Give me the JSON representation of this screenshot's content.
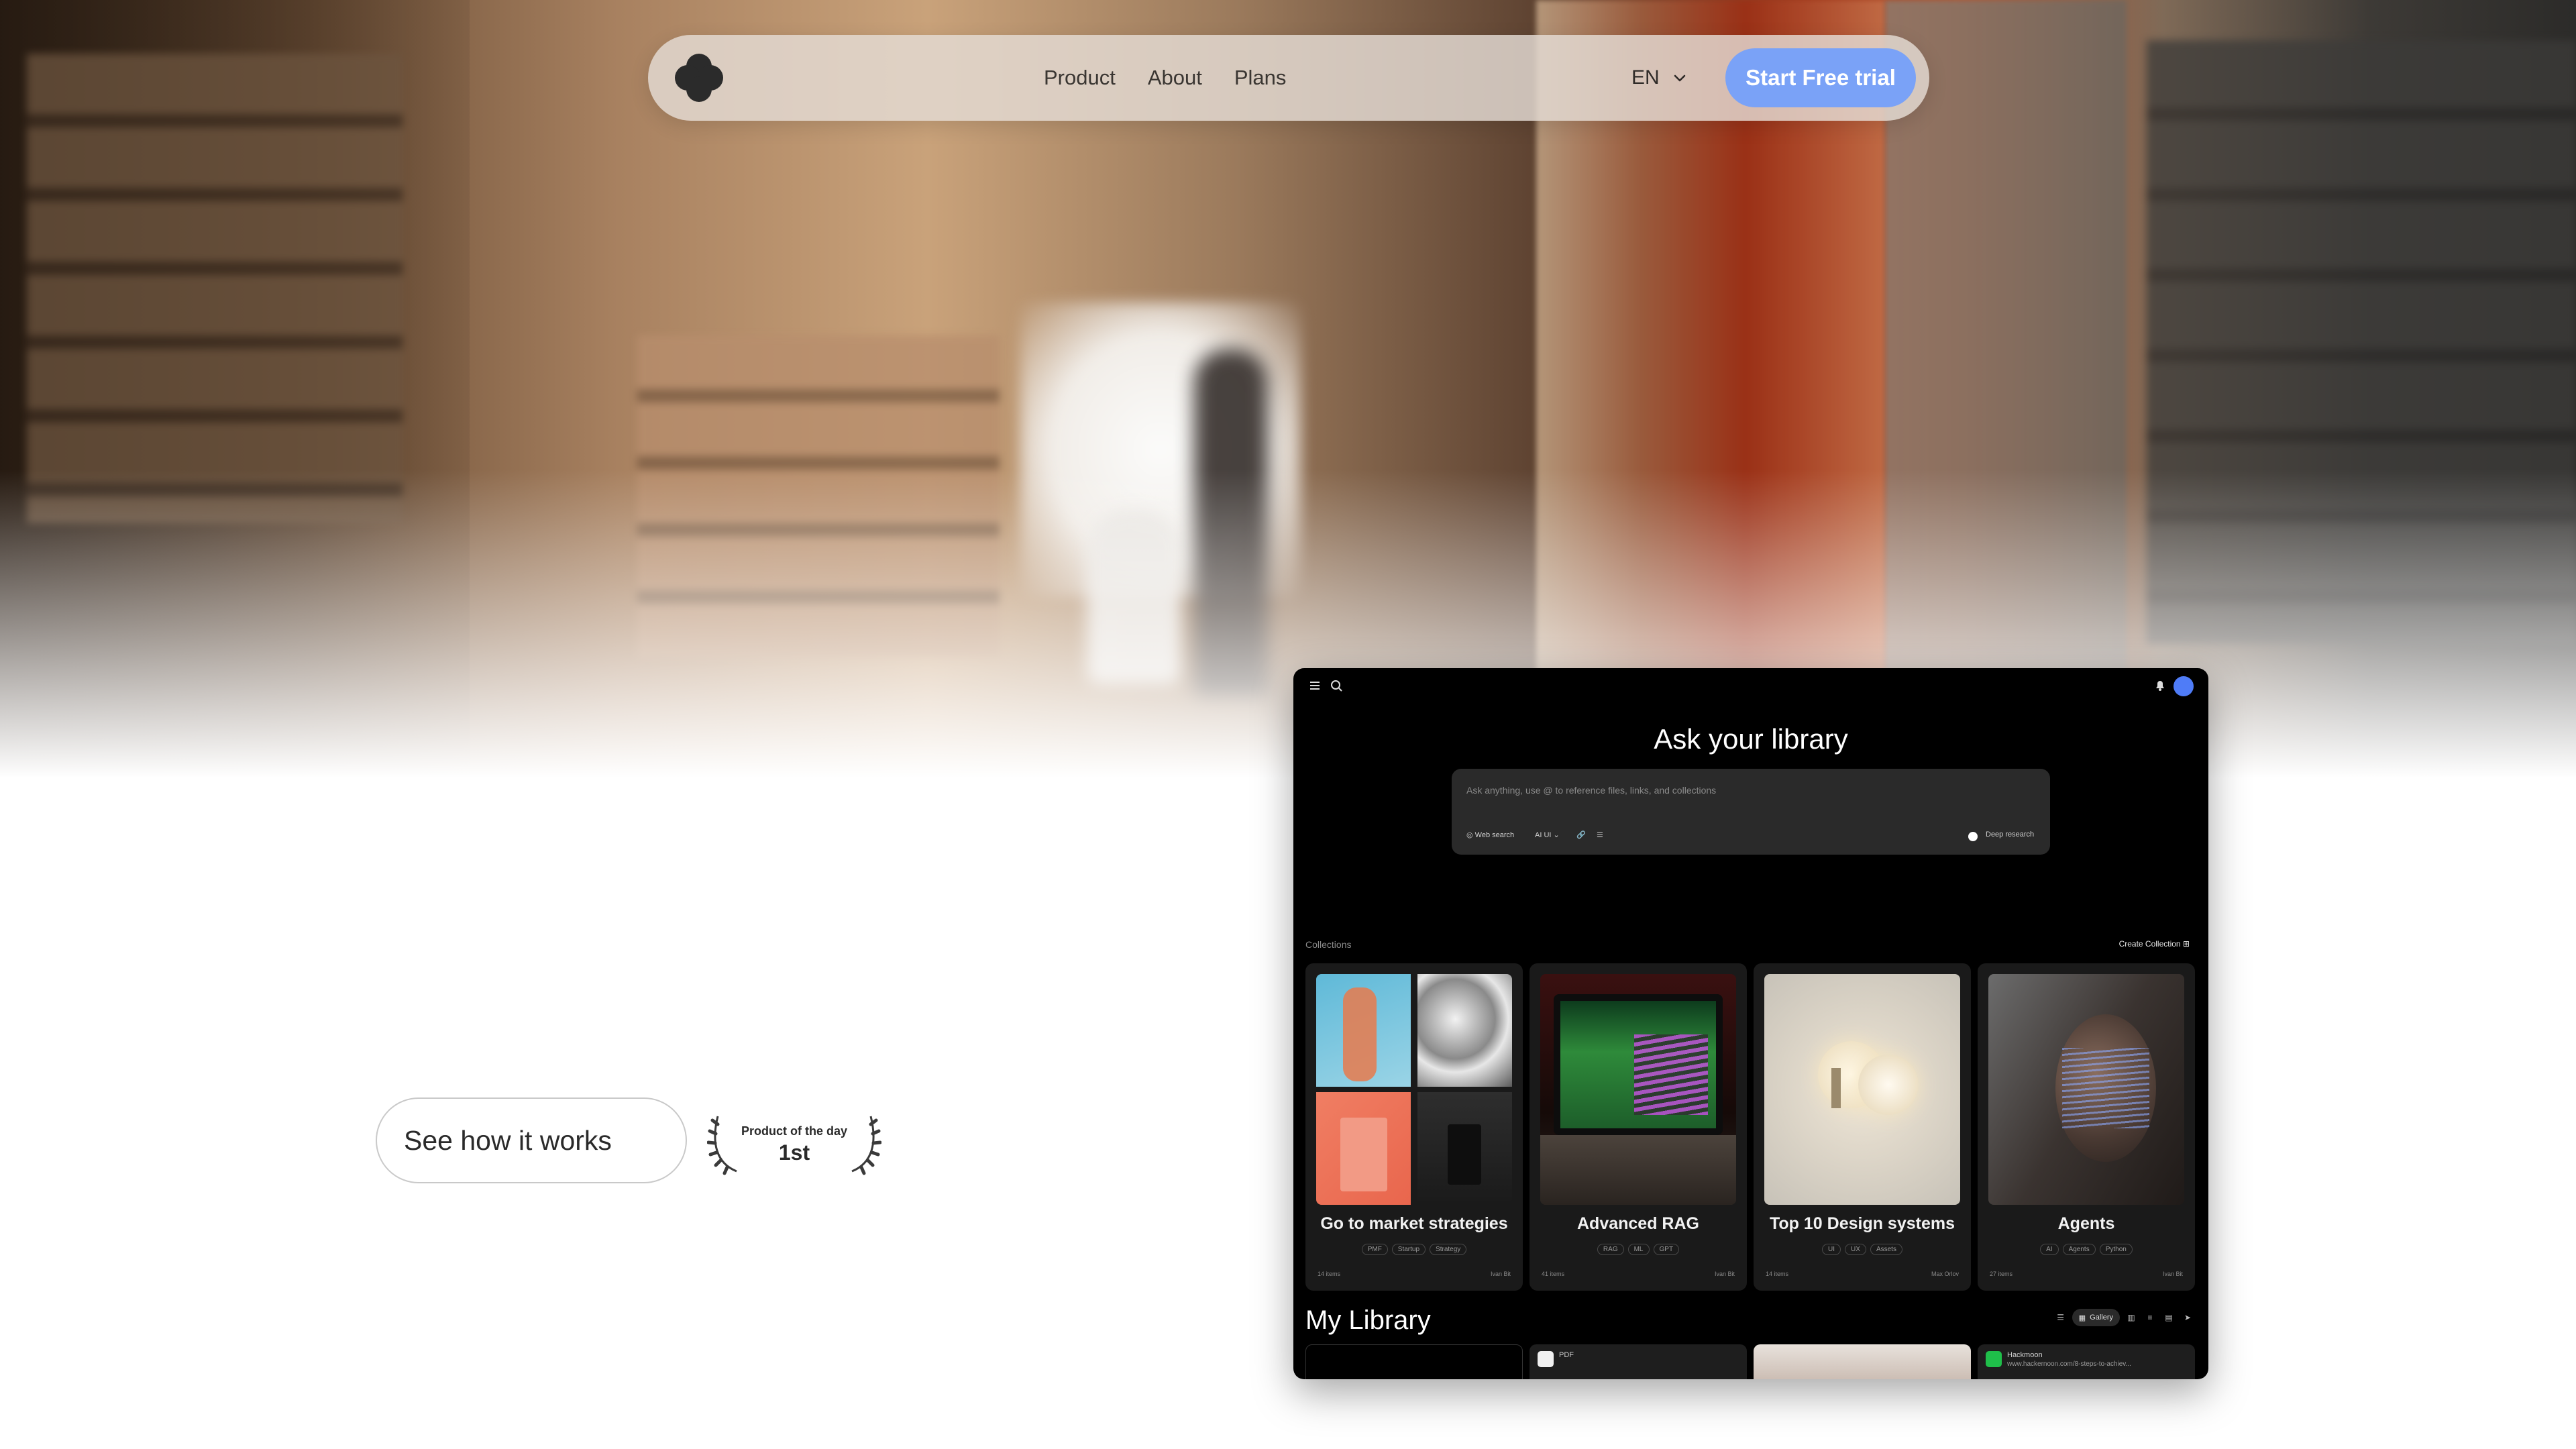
{
  "nav": {
    "links": [
      "Product",
      "About",
      "Plans"
    ],
    "language": "EN",
    "cta_label": "Start Free trial"
  },
  "hero": {
    "secondary_cta": "See how it works",
    "award": {
      "line1": "Product of the day",
      "line2": "1st"
    }
  },
  "app": {
    "headline": "Ask your library",
    "ask_placeholder": "Ask anything, use @ to reference files, links, and collections",
    "tools": {
      "web_search": "Web search",
      "model": "AI UI",
      "deep_research": "Deep research"
    },
    "collections_label": "Collections",
    "create_collection": "Create Collection",
    "collections": [
      {
        "title": "Go to market strategies",
        "tags": [
          "PMF",
          "Startup",
          "Strategy"
        ],
        "count": "14 items",
        "owner": "Ivan Bit"
      },
      {
        "title": "Advanced RAG",
        "tags": [
          "RAG",
          "ML",
          "GPT"
        ],
        "count": "41 items",
        "owner": "Ivan Bit"
      },
      {
        "title": "Top 10 Design systems",
        "tags": [
          "UI",
          "UX",
          "Assets"
        ],
        "count": "14 items",
        "owner": "Max Orlov"
      },
      {
        "title": "Agents",
        "tags": [
          "AI",
          "Agents",
          "Python"
        ],
        "count": "27 items",
        "owner": "Ivan Bit"
      }
    ],
    "my_library": "My Library",
    "view_mode": "Gallery",
    "library_items": [
      {
        "type": "",
        "subtitle": ""
      },
      {
        "type": "PDF",
        "subtitle": ""
      },
      {
        "type": "",
        "subtitle": ""
      },
      {
        "type": "Hackmoon",
        "subtitle": "www.hackernoon.com/8-steps-to-achiev..."
      }
    ]
  }
}
